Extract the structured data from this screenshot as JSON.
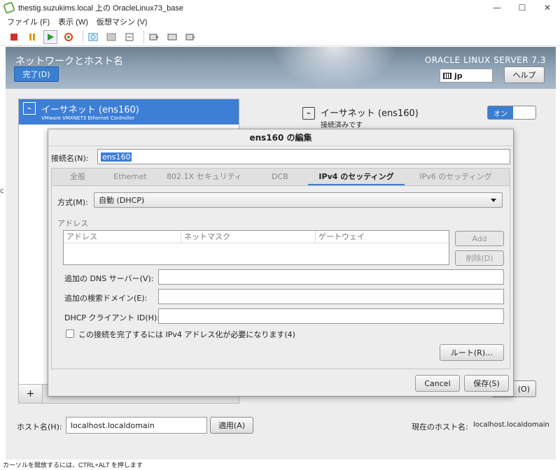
{
  "window": {
    "title": "thestig.suzukims.local 上の OracleLinux73_base",
    "minimize": "—",
    "maximize": "☐",
    "close": "✕"
  },
  "menu": [
    "ファイル (F)",
    "表示 (W)",
    "仮想マシン (V)"
  ],
  "toolbar_icons": [
    "stop-icon",
    "pause-icon",
    "play-icon",
    "refresh-icon",
    "snapshot-icon",
    "snapshot-manager-icon",
    "revert-icon",
    "console-icon",
    "fullscreen-icon",
    "send-keys-icon"
  ],
  "header": {
    "title": "ネットワークとホスト名",
    "done_label": "完了(D)",
    "product": "ORACLE LINUX SERVER 7.3",
    "keyboard": "jp",
    "help_label": "ヘルプ"
  },
  "device": {
    "name": "イーサネット (ens160)",
    "controller": "VMware VMXNET3 Ethernet Controller",
    "detail_name": "イーサネット (ens160)",
    "detail_status": "接続済みです",
    "toggle_label": "オン",
    "add_label": "+",
    "config_label": "(O)"
  },
  "host": {
    "label": "ホスト名(H):",
    "value": "localhost.localdomain",
    "apply_label": "適用(A)",
    "current_label": "現在のホスト名:",
    "current_value": "localhost.localdomain"
  },
  "dialog": {
    "title": "ens160 の編集",
    "conn_name_label": "接続名(N):",
    "conn_name_value": "ens160",
    "tabs": [
      "全般",
      "Ethernet",
      "802.1X セキュリティ",
      "DCB",
      "IPv4 のセッティング",
      "IPv6 のセッティング"
    ],
    "method_label": "方式(M):",
    "method_value": "自動 (DHCP)",
    "address_section": "アドレス",
    "addr_columns": [
      "アドレス",
      "ネットマスク",
      "ゲートウェイ"
    ],
    "add_label": "Add",
    "delete_label": "削除(D)",
    "dns_label": "追加の DNS サーバー(V):",
    "search_label": "追加の検索ドメイン(E):",
    "dhcp_label": "DHCP クライアント ID(H):",
    "checkbox_label": "この接続を完了するには IPv4 アドレス化が必要になります(4)",
    "routes_label": "ルート(R)…",
    "cancel_label": "Cancel",
    "save_label": "保存(S)"
  },
  "left_fragment": "c",
  "status_bar": "カーソルを開放するには、CTRL+ALT を押します"
}
